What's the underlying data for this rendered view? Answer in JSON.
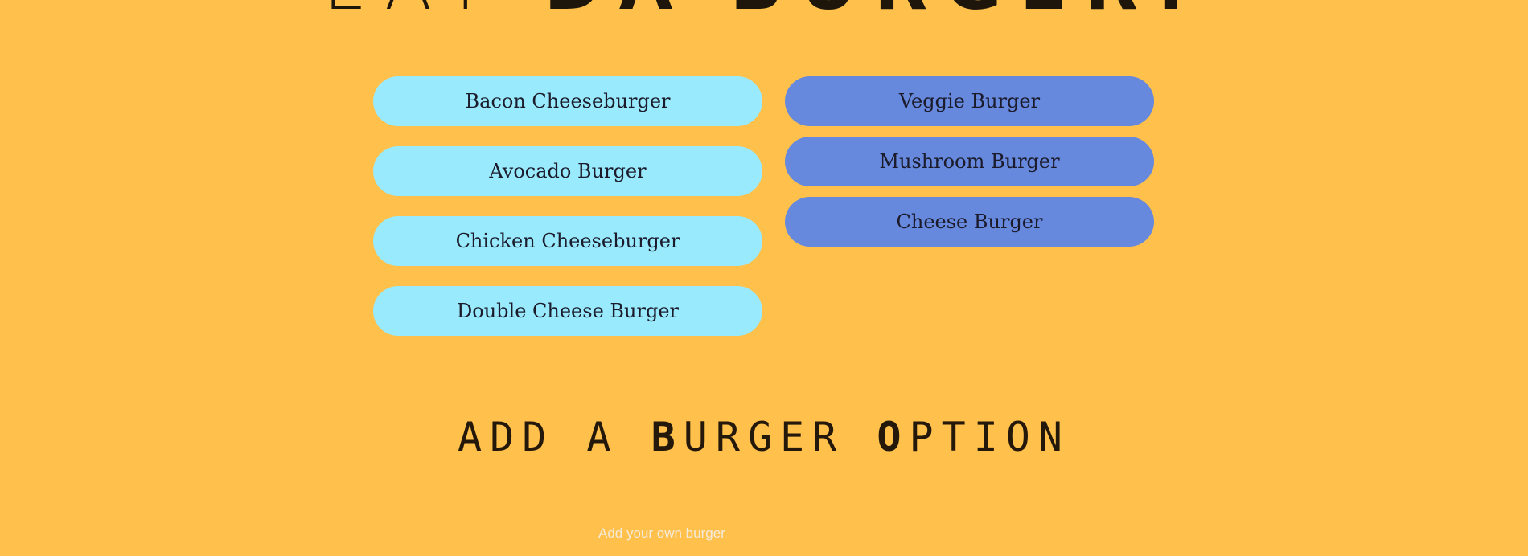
{
  "header": {
    "title_part1": "EAT",
    "title_part2": "DA",
    "title_part3": "BURGER!"
  },
  "uneaten": {
    "items": [
      {
        "label": "Bacon Cheeseburger"
      },
      {
        "label": "Avocado Burger"
      },
      {
        "label": "Chicken Cheeseburger"
      },
      {
        "label": "Double Cheese Burger"
      }
    ]
  },
  "devoured": {
    "items": [
      {
        "label": "Veggie Burger"
      },
      {
        "label": "Mushroom Burger"
      },
      {
        "label": "Cheese Burger"
      }
    ]
  },
  "add_section": {
    "title_a1": "ADD",
    "title_a2": "A",
    "title_b_bold": "B",
    "title_b_rest": "URGER",
    "title_o_bold": "O",
    "title_o_rest": "PTION",
    "input_placeholder": "Add your own burger"
  },
  "colors": {
    "background": "#FFC04C",
    "uneaten_button": "#98EAFC",
    "devoured_button": "#6688DD",
    "text": "#1b1b2b"
  }
}
